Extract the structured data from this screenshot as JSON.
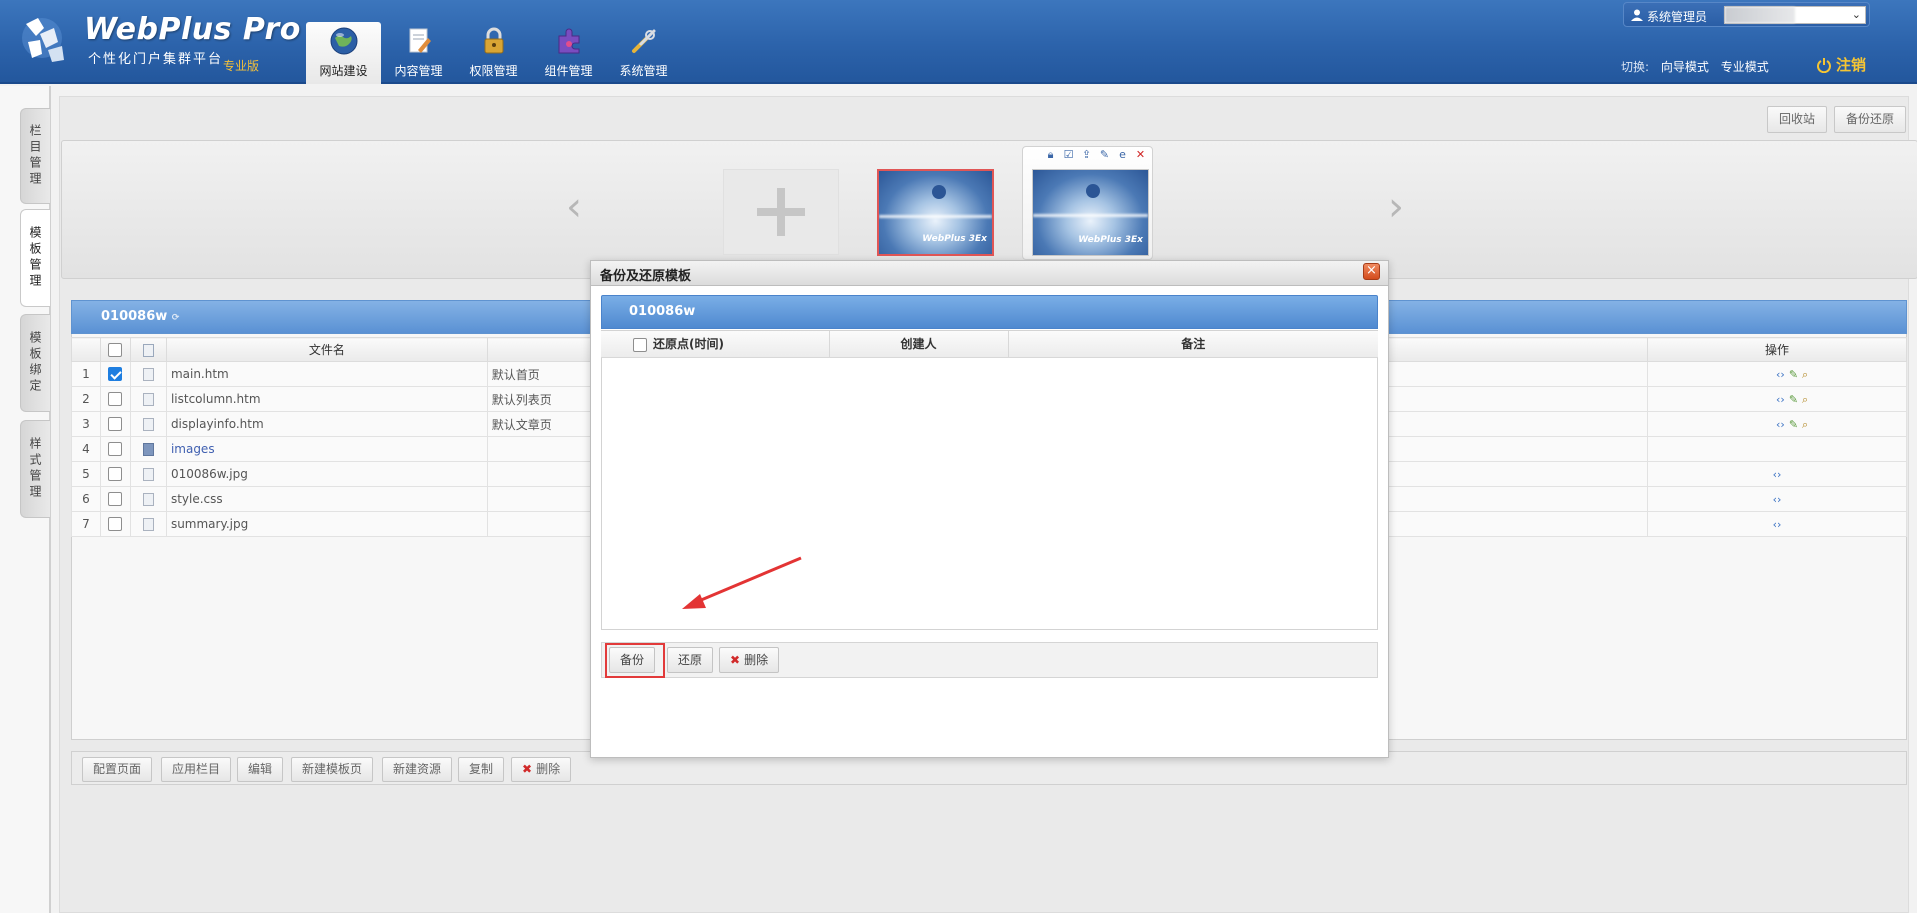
{
  "header": {
    "title": "WebPlus Pro",
    "subtitle": "个性化门户集群平台",
    "edition": "专业版",
    "nav": [
      {
        "label": "网站建设",
        "icon": "globe-icon",
        "active": true
      },
      {
        "label": "内容管理",
        "icon": "document-edit-icon",
        "active": false
      },
      {
        "label": "权限管理",
        "icon": "lock-icon",
        "active": false
      },
      {
        "label": "组件管理",
        "icon": "puzzle-icon",
        "active": false
      },
      {
        "label": "系统管理",
        "icon": "tools-icon",
        "active": false
      }
    ],
    "user_label": "系统管理员",
    "switch_label": "切换:",
    "mode_guide": "向导模式",
    "mode_pro": "专业模式",
    "logout": "注销"
  },
  "side_tabs": [
    "栏目管理",
    "模板管理",
    "模板绑定",
    "样式管理"
  ],
  "toolbar": {
    "recycle_bin": "回收站",
    "backup_restore": "备份还原"
  },
  "template_panel": {
    "name": "010086w",
    "columns": [
      "文件名",
      "操作"
    ],
    "rows": [
      {
        "index": "1",
        "checked": true,
        "file": "main.htm",
        "desc": "默认首页",
        "is_folder": false
      },
      {
        "index": "2",
        "checked": false,
        "file": "listcolumn.htm",
        "desc": "默认列表页",
        "is_folder": false
      },
      {
        "index": "3",
        "checked": false,
        "file": "displayinfo.htm",
        "desc": "默认文章页",
        "is_folder": false
      },
      {
        "index": "4",
        "checked": false,
        "file": "images",
        "desc": "",
        "is_folder": true
      },
      {
        "index": "5",
        "checked": false,
        "file": "010086w.jpg",
        "desc": "",
        "is_folder": false
      },
      {
        "index": "6",
        "checked": false,
        "file": "style.css",
        "desc": "",
        "is_folder": false
      },
      {
        "index": "7",
        "checked": false,
        "file": "summary.jpg",
        "desc": "",
        "is_folder": false
      }
    ],
    "actions": [
      "配置页面",
      "应用栏目",
      "编辑",
      "新建模板页",
      "新建资源",
      "复制",
      "删除"
    ]
  },
  "thumbnail": {
    "brand": "WebPlus 3Ex"
  },
  "modal": {
    "title": "备份及还原模板",
    "template_name": "010086w",
    "columns": [
      "还原点(时间)",
      "创建人",
      "备注"
    ],
    "buttons": {
      "backup": "备份",
      "restore": "还原",
      "delete": "删除"
    }
  },
  "colors": {
    "header_blue": "#2c63ab",
    "panel_blue": "#5a91d4",
    "logout_gold": "#f5c534",
    "highlight_red": "#e23a3a"
  }
}
